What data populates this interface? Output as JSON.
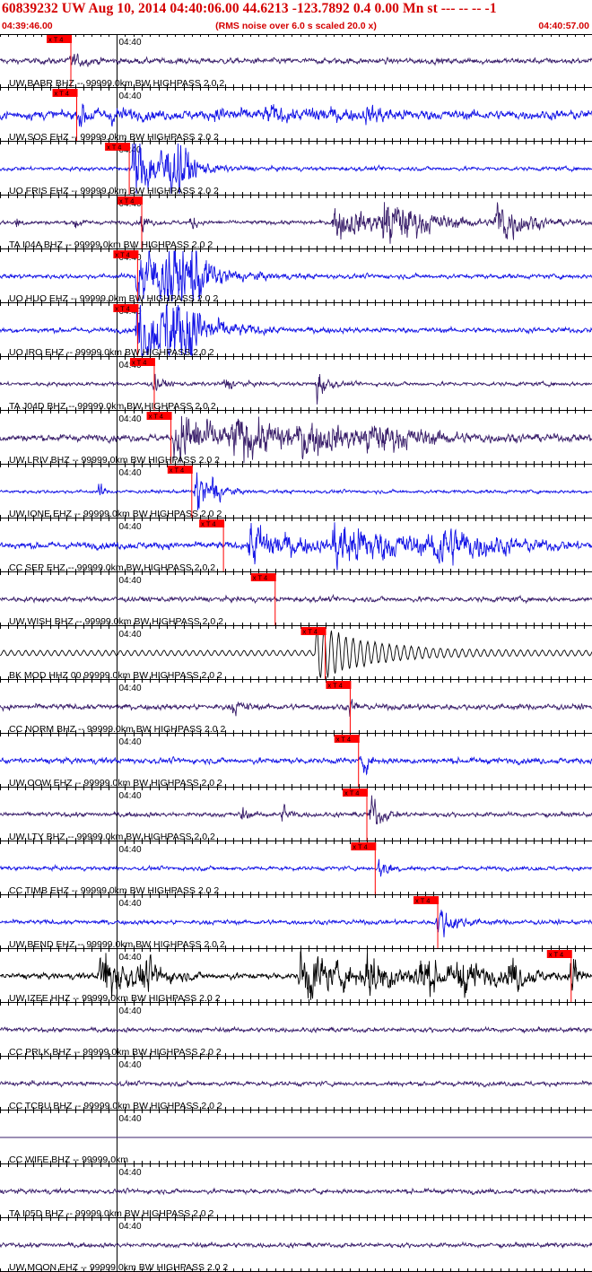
{
  "header": {
    "title": "60839232 UW Aug 10, 2014 04:40:06.00   44.6213 -123.7892  0.4 0.00 Mn st --- -- --  -1",
    "start_time": "04:39:46.00",
    "note": "(RMS noise over 6.0 s scaled 20.0 x)",
    "end_time": "04:40:57.00"
  },
  "plot": {
    "time_start_s": 46.0,
    "time_end_s": 117.0,
    "time_tick_label": "04:40",
    "time_tick_s": 60.0,
    "phase_label": "x T 4",
    "colors": {
      "purple": "#3a1f6b",
      "blue": "#1414e6",
      "black": "#000000",
      "pick": "#ff0000"
    }
  },
  "traces": [
    {
      "label": "UW BABR BHZ -- 99999.0km BW  HIGHPASS  2.0  2",
      "color": "purple",
      "pick_s": 54.5,
      "amp": 0.1,
      "bursts": [
        [
          54.5,
          1.5,
          0.25
        ]
      ]
    },
    {
      "label": "UW SOS EHZ -- 99999.0km BW  HIGHPASS  2.0  2",
      "color": "blue",
      "pick_s": 55.2,
      "amp": 0.16,
      "bursts": [
        [
          55.6,
          1.2,
          0.45
        ],
        [
          59.0,
          2.0,
          0.25
        ],
        [
          72.0,
          3.0,
          0.2
        ],
        [
          78.0,
          2.5,
          0.25
        ],
        [
          83.0,
          3.0,
          0.25
        ],
        [
          90.0,
          3.0,
          0.22
        ]
      ]
    },
    {
      "label": "UO FRIS EHZ -- 99999.0km BW  HIGHPASS  2.0  2",
      "color": "blue",
      "pick_s": 61.5,
      "amp": 0.07,
      "bursts": [
        [
          62.0,
          3.0,
          1.4
        ],
        [
          65.5,
          2.0,
          0.8
        ],
        [
          67.5,
          0.8,
          0.9
        ]
      ]
    },
    {
      "label": "TA I04A BHZ -- 99999.0km BW  HIGHPASS  2.0  2",
      "color": "purple",
      "pick_s": 63.0,
      "amp": 0.07,
      "bursts": [
        [
          48.0,
          0.4,
          0.3
        ],
        [
          55.0,
          0.4,
          0.3
        ],
        [
          63.0,
          0.5,
          0.5
        ],
        [
          69.0,
          0.4,
          0.4
        ],
        [
          86.0,
          6.0,
          0.6
        ],
        [
          92.0,
          4.0,
          0.8
        ],
        [
          105.5,
          2.5,
          1.0
        ]
      ]
    },
    {
      "label": "UO HUO EHZ -- 99999.0km BW  HIGHPASS  2.0  2",
      "color": "blue",
      "pick_s": 62.5,
      "amp": 0.08,
      "bursts": [
        [
          62.5,
          4.0,
          1.5
        ],
        [
          66.0,
          3.0,
          1.1
        ],
        [
          69.0,
          1.0,
          1.0
        ]
      ]
    },
    {
      "label": "UO IRO EHZ -- 99999.0km BW  HIGHPASS  2.0  2",
      "color": "blue",
      "pick_s": 62.5,
      "amp": 0.09,
      "bursts": [
        [
          62.5,
          4.0,
          1.5
        ],
        [
          66.0,
          3.0,
          1.2
        ],
        [
          68.5,
          1.0,
          1.0
        ]
      ]
    },
    {
      "label": "TA J04D BHZ -- 99999.0km BW  HIGHPASS  2.0  2",
      "color": "purple",
      "pick_s": 64.5,
      "amp": 0.07,
      "bursts": [
        [
          64.5,
          0.8,
          0.35
        ],
        [
          84.0,
          0.8,
          0.8
        ],
        [
          73.0,
          1.0,
          0.25
        ]
      ]
    },
    {
      "label": "UW LRIV BHZ -- 99999.0km BW  HIGHPASS  2.0  2",
      "color": "purple",
      "pick_s": 66.5,
      "amp": 0.12,
      "bursts": [
        [
          67.0,
          5.0,
          1.1
        ],
        [
          74.0,
          8.0,
          0.55
        ],
        [
          82.0,
          6.0,
          0.45
        ],
        [
          90.0,
          6.0,
          0.35
        ]
      ]
    },
    {
      "label": "UW IONE EHZ -- 99999.0km BW  HIGHPASS  2.0  2",
      "color": "blue",
      "pick_s": 69.0,
      "amp": 0.06,
      "bursts": [
        [
          69.5,
          1.2,
          1.1
        ],
        [
          71.5,
          1.0,
          0.5
        ],
        [
          58.0,
          0.3,
          0.4
        ]
      ]
    },
    {
      "label": "CC SEP EHZ -- 99999.0km BW  HIGHPASS  2.0  2",
      "color": "blue",
      "pick_s": 72.8,
      "amp": 0.12,
      "bursts": [
        [
          76.0,
          4.0,
          0.9
        ],
        [
          86.0,
          8.0,
          0.85
        ],
        [
          98.0,
          5.0,
          0.75
        ]
      ]
    },
    {
      "label": "UW WISH BHZ -- 99999.0km BW  HIGHPASS  2.0  2",
      "color": "purple",
      "pick_s": 79.0,
      "amp": 0.09,
      "bursts": []
    },
    {
      "label": "BK MOD HHZ 00 99999.0km BW  HIGHPASS  2.0  2",
      "color": "black",
      "pick_s": 85.0,
      "amp": 0.12,
      "bursts": [
        [
          84.0,
          6.0,
          1.2
        ]
      ]
    },
    {
      "label": "CC NORM BHZ -- 99999.0km BW  HIGHPASS  2.0  2",
      "color": "purple",
      "pick_s": 88.0,
      "amp": 0.1,
      "bursts": [
        [
          88.0,
          0.5,
          0.3
        ],
        [
          74.0,
          1.0,
          0.25
        ]
      ]
    },
    {
      "label": "UW OOW EHZ -- 99999.0km BW  HIGHPASS  2.0  2",
      "color": "blue",
      "pick_s": 89.0,
      "amp": 0.1,
      "bursts": [
        [
          89.5,
          0.6,
          0.55
        ]
      ]
    },
    {
      "label": "UW LTY BHZ -- 99999.0km BW  HIGHPASS  2.0  2",
      "color": "purple",
      "pick_s": 90.0,
      "amp": 0.08,
      "bursts": [
        [
          90.5,
          1.0,
          0.8
        ],
        [
          80.0,
          0.6,
          0.4
        ],
        [
          75.0,
          0.5,
          0.3
        ]
      ]
    },
    {
      "label": "CC TIMB EHZ -- 99999.0km BW  HIGHPASS  2.0  2",
      "color": "blue",
      "pick_s": 91.0,
      "amp": 0.07,
      "bursts": [
        [
          91.5,
          1.0,
          0.5
        ]
      ]
    },
    {
      "label": "UW BEND EHZ -- 99999.0km BW  HIGHPASS  2.0  2",
      "color": "blue",
      "pick_s": 98.5,
      "amp": 0.08,
      "bursts": [
        [
          98.5,
          1.6,
          0.7
        ]
      ]
    },
    {
      "label": "UW IZEE HHZ -- 99999.0km BW  HIGHPASS  2.0  2",
      "color": "black",
      "pick_s": 114.5,
      "amp": 0.1,
      "bursts": [
        [
          58.0,
          3.0,
          1.1
        ],
        [
          63.0,
          2.0,
          0.5
        ],
        [
          82.0,
          5.0,
          1.0
        ],
        [
          90.0,
          3.0,
          0.7
        ],
        [
          96.0,
          3.0,
          0.7
        ],
        [
          101.0,
          3.0,
          0.6
        ],
        [
          107.0,
          2.0,
          0.6
        ],
        [
          114.5,
          0.8,
          1.1
        ]
      ]
    },
    {
      "label": "CC PRLK BHZ -- 99999.0km BW  HIGHPASS  2.0  2",
      "color": "purple",
      "pick_s": null,
      "amp": 0.08,
      "bursts": []
    },
    {
      "label": "CC TCBU BHZ -- 99999.0km BW  HIGHPASS  2.0  2",
      "color": "purple",
      "pick_s": null,
      "amp": 0.08,
      "bursts": []
    },
    {
      "label": "CC WIFE BHZ -- 99999.0km",
      "color": "purple",
      "pick_s": null,
      "amp": 0.0,
      "bursts": []
    },
    {
      "label": "TA I05D BHZ -- 99999.0km BW  HIGHPASS  2.0  2",
      "color": "purple",
      "pick_s": null,
      "amp": 0.08,
      "bursts": []
    },
    {
      "label": "UW MOON EHZ -- 99999.0km BW  HIGHPASS  2.0  2",
      "color": "purple",
      "pick_s": null,
      "amp": 0.08,
      "bursts": []
    }
  ]
}
